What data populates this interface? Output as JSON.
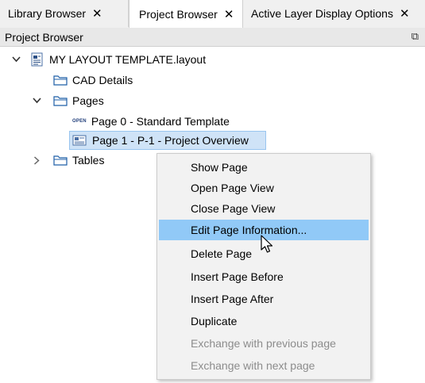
{
  "tabs": [
    {
      "label": "Library Browser",
      "close": "✕"
    },
    {
      "label": "Project Browser",
      "close": "✕"
    },
    {
      "label": "Active Layer Display Options",
      "close": "✕"
    }
  ],
  "panel": {
    "title": "Project Browser",
    "float_icon": "⧉",
    "close_partial": "×"
  },
  "tree": {
    "root_label": "MY LAYOUT TEMPLATE.layout",
    "cad_details": "CAD Details",
    "pages": "Pages",
    "open_badge": "OPEN",
    "page0": "Page 0 - Standard Template",
    "page1": "Page 1 - P-1 - Project Overview",
    "tables": "Tables"
  },
  "context_menu": {
    "items": [
      {
        "label": "Show Page"
      },
      {
        "label": "Open Page View"
      },
      {
        "label": "Close Page View"
      },
      {
        "label": "Edit Page Information..."
      },
      {
        "label": "Delete Page"
      },
      {
        "label": "Insert Page Before"
      },
      {
        "label": "Insert Page After"
      },
      {
        "label": "Duplicate"
      },
      {
        "label": "Exchange with previous page"
      },
      {
        "label": "Exchange with next page"
      }
    ]
  },
  "colors": {
    "hover": "#91c9f7",
    "selected_row": "#cfe3f7",
    "disabled_text": "#8c8c8c"
  }
}
